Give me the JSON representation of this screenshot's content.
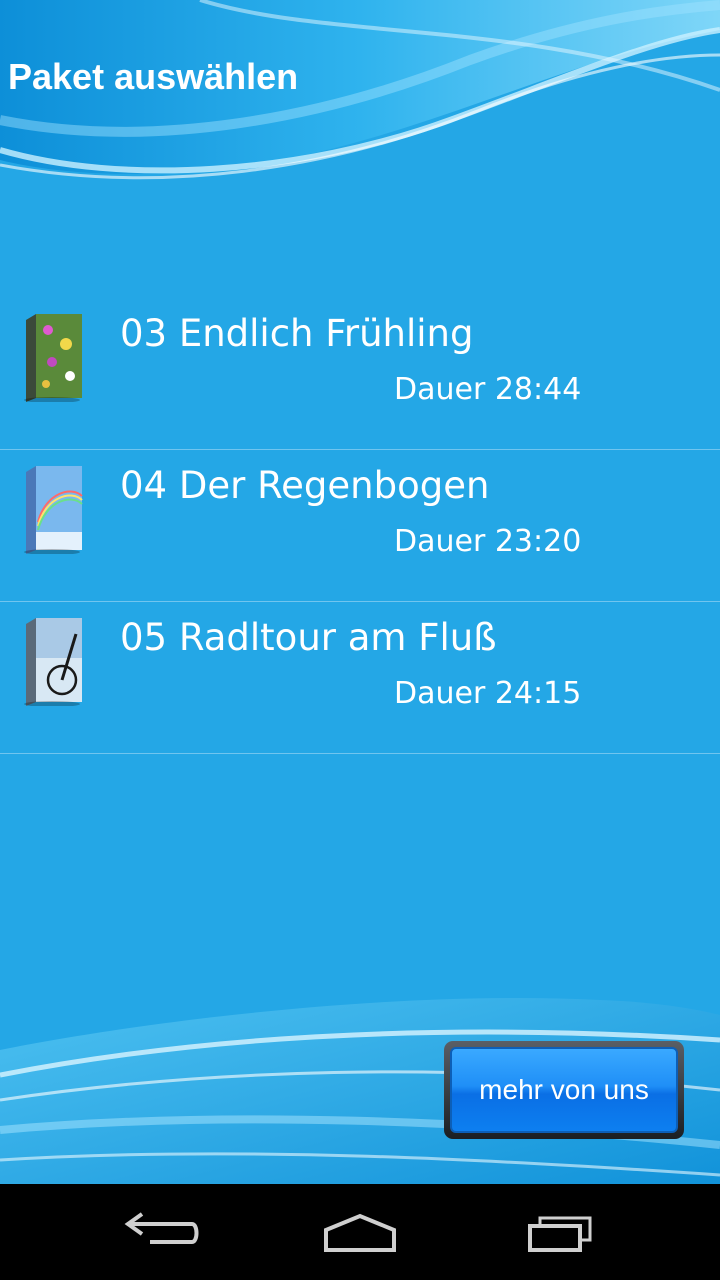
{
  "header": {
    "title": "Paket auswählen"
  },
  "packages": [
    {
      "title": "03 Endlich Frühling",
      "duration": "Dauer 28:44",
      "cover": "spring-cover-icon"
    },
    {
      "title": "04 Der Regenbogen",
      "duration": "Dauer 23:20",
      "cover": "rainbow-cover-icon"
    },
    {
      "title": "05 Radltour am Fluß",
      "duration": "Dauer 24:15",
      "cover": "bicycle-cover-icon"
    }
  ],
  "more_button": {
    "label": "mehr von uns"
  },
  "nav": {
    "back": "back-icon",
    "home": "home-icon",
    "recents": "recents-icon"
  },
  "colors": {
    "background": "#24a7e6",
    "button": "#1f8ff7",
    "navbar": "#000000"
  }
}
